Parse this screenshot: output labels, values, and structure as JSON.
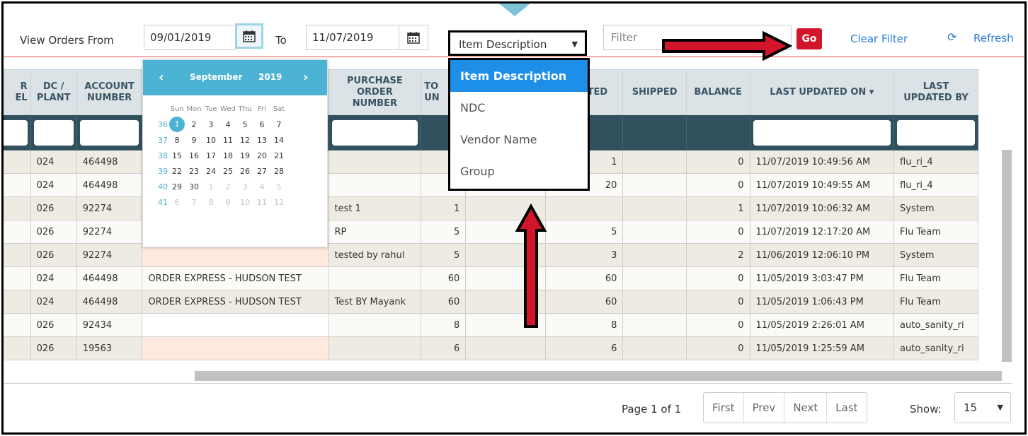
{
  "toolbar": {
    "view_from_label": "View Orders From",
    "from_date": "09/01/2019",
    "to_label": "To",
    "to_date": "11/07/2019",
    "search_by": "Item Description",
    "filter_placeholder": "Filter",
    "go_label": "Go",
    "clear_filter_label": "Clear Filter",
    "refresh_label": "Refresh"
  },
  "calendar": {
    "month": "September",
    "year": "2019",
    "days_of_week": [
      "Sun",
      "Mon",
      "Tue",
      "Wed",
      "Thu",
      "Fri",
      "Sat"
    ],
    "weeks": [
      {
        "wk": "36",
        "days": [
          "1",
          "2",
          "3",
          "4",
          "5",
          "6",
          "7"
        ]
      },
      {
        "wk": "37",
        "days": [
          "8",
          "9",
          "10",
          "11",
          "12",
          "13",
          "14"
        ]
      },
      {
        "wk": "38",
        "days": [
          "15",
          "16",
          "17",
          "18",
          "19",
          "20",
          "21"
        ]
      },
      {
        "wk": "39",
        "days": [
          "22",
          "23",
          "24",
          "25",
          "26",
          "27",
          "28"
        ]
      },
      {
        "wk": "40",
        "days": [
          "29",
          "30",
          "1",
          "2",
          "3",
          "4",
          "5"
        ]
      },
      {
        "wk": "41",
        "days": [
          "6",
          "7",
          "8",
          "9",
          "10",
          "11",
          "12"
        ]
      }
    ],
    "selected_day": "1"
  },
  "dropdown": {
    "options": [
      "Item Description",
      "NDC",
      "Vendor Name",
      "Group"
    ],
    "selected": "Item Description"
  },
  "table": {
    "headers": [
      "R\nEL",
      "DC /\nPLANT",
      "ACCOUNT\nNUMBER",
      "",
      "PURCHASE\nORDER\nNUMBER",
      "TO\nUN",
      "",
      "LOCATED",
      "SHIPPED",
      "BALANCE",
      "LAST UPDATED ON ▾",
      "LAST\nUPDATED BY"
    ],
    "rows": [
      {
        "dc": "024",
        "acct": "464498",
        "desc": "",
        "po": "",
        "tot": "",
        "col7": "",
        "alloc": "1",
        "shipped": "",
        "bal": "0",
        "updated": "11/07/2019 10:49:56 AM",
        "by": "flu_ri_4"
      },
      {
        "dc": "024",
        "acct": "464498",
        "desc": "",
        "po": "",
        "tot": "20",
        "col7": "",
        "alloc": "20",
        "shipped": "",
        "bal": "0",
        "updated": "11/07/2019 10:49:55 AM",
        "by": "flu_ri_4"
      },
      {
        "dc": "026",
        "acct": "92274",
        "desc": "",
        "po": "test 1",
        "tot": "1",
        "col7": "",
        "alloc": "",
        "shipped": "",
        "bal": "1",
        "updated": "11/07/2019 10:06:32 AM",
        "by": "System"
      },
      {
        "dc": "026",
        "acct": "92274",
        "desc": "",
        "po": "RP",
        "tot": "5",
        "col7": "",
        "alloc": "5",
        "shipped": "",
        "bal": "0",
        "updated": "11/07/2019 12:17:20 AM",
        "by": "Flu Team"
      },
      {
        "dc": "026",
        "acct": "92274",
        "desc": "",
        "po": "tested by rahul",
        "tot": "5",
        "col7": "",
        "alloc": "3",
        "shipped": "",
        "bal": "2",
        "updated": "11/06/2019 12:06:10 PM",
        "by": "System"
      },
      {
        "dc": "024",
        "acct": "464498",
        "desc": "ORDER EXPRESS - HUDSON TEST",
        "po": "",
        "tot": "60",
        "col7": "",
        "alloc": "60",
        "shipped": "",
        "bal": "0",
        "updated": "11/05/2019 3:03:47 PM",
        "by": "Flu Team"
      },
      {
        "dc": "024",
        "acct": "464498",
        "desc": "ORDER EXPRESS - HUDSON TEST",
        "po": "Test BY Mayank",
        "tot": "60",
        "col7": "",
        "alloc": "60",
        "shipped": "",
        "bal": "0",
        "updated": "11/05/2019 1:06:43 PM",
        "by": "Flu Team"
      },
      {
        "dc": "026",
        "acct": "92434",
        "desc": "",
        "po": "",
        "tot": "8",
        "col7": "",
        "alloc": "8",
        "shipped": "",
        "bal": "0",
        "updated": "11/05/2019 2:26:01 AM",
        "by": "auto_sanity_ri"
      },
      {
        "dc": "026",
        "acct": "19563",
        "desc": "",
        "po": "",
        "tot": "6",
        "col7": "",
        "alloc": "6",
        "shipped": "",
        "bal": "0",
        "updated": "11/05/2019 1:25:59 AM",
        "by": "auto_sanity_ri"
      }
    ]
  },
  "pagination": {
    "page_label": "Page 1 of 1",
    "first": "First",
    "prev": "Prev",
    "next": "Next",
    "last": "Last",
    "show_label": "Show:",
    "page_size": "15"
  },
  "colors": {
    "go": "#d3152b",
    "link": "#2a7bd5",
    "calendar_header": "#4cb3d4",
    "dropdown_active": "#1e8fe8",
    "arrow": "#d3152b"
  }
}
